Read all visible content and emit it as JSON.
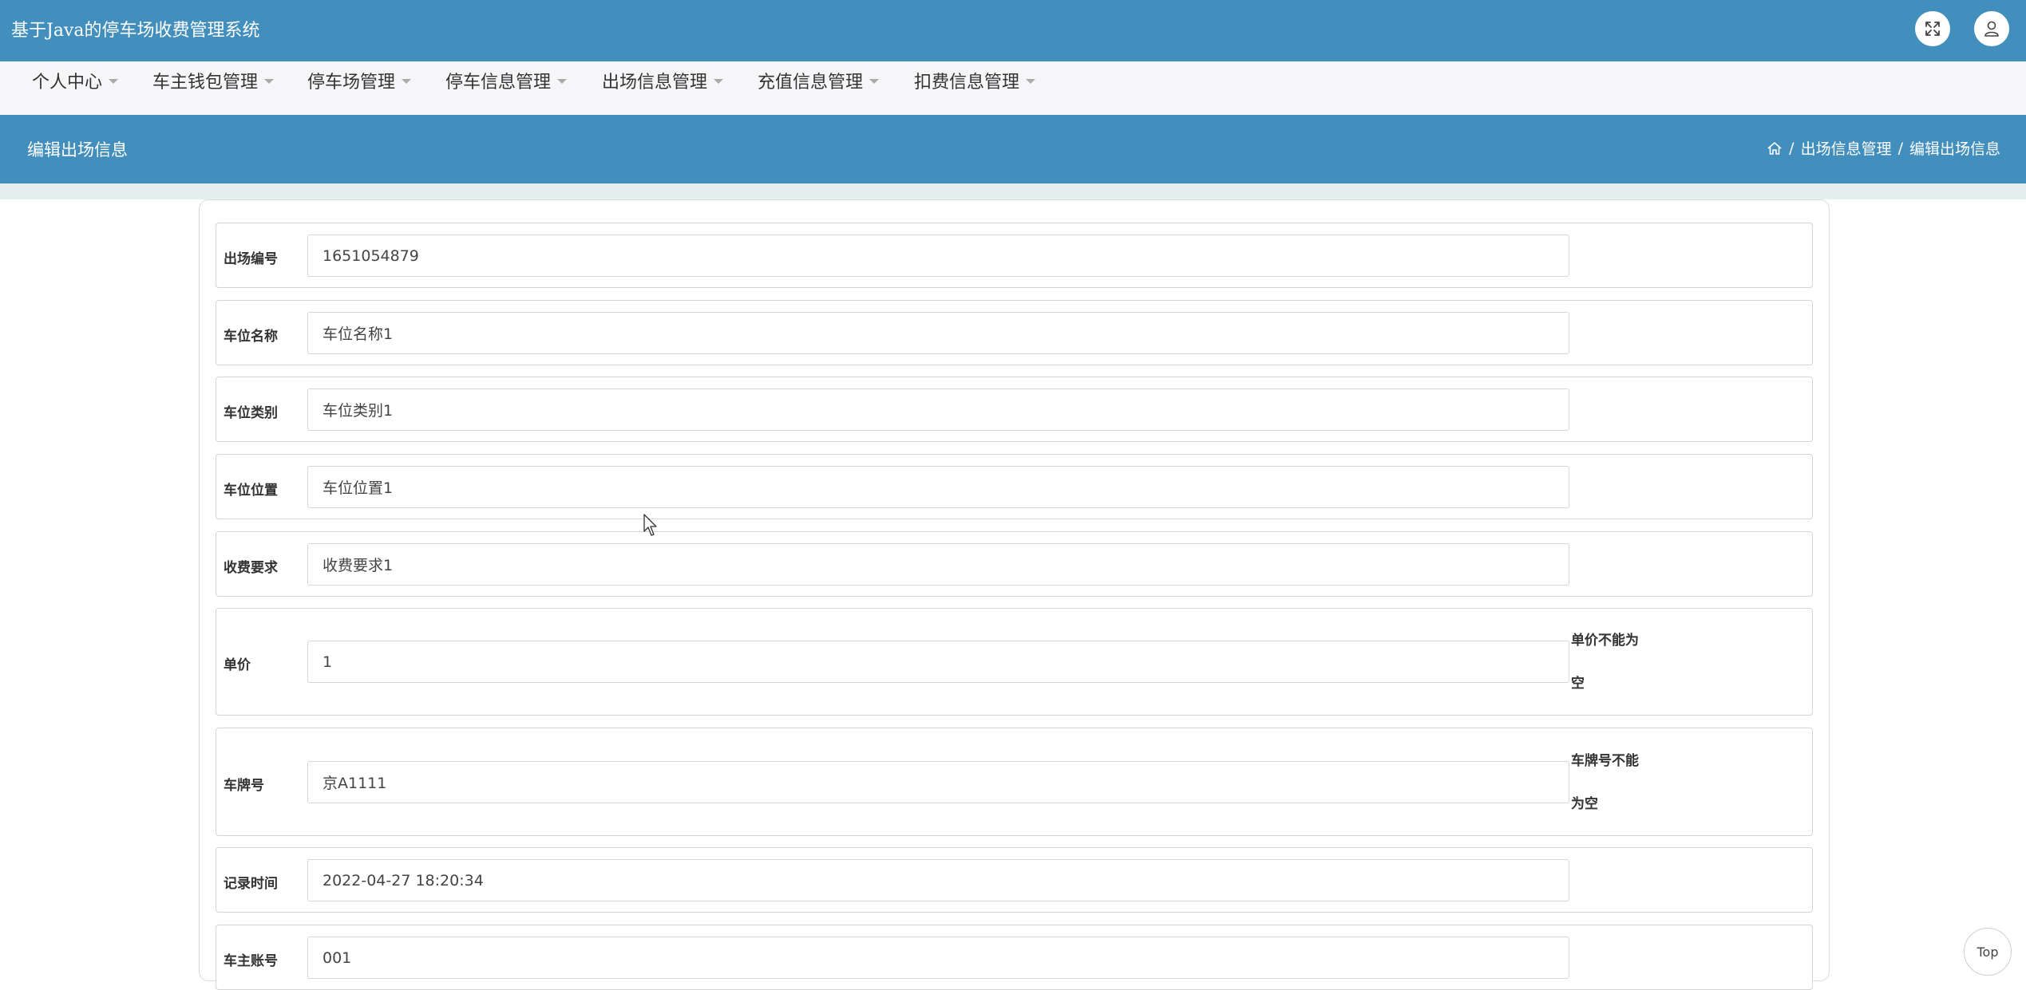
{
  "app": {
    "title": "基于Java的停车场收费管理系统"
  },
  "header_icons": {
    "fullscreen": "fullscreen-icon",
    "user": "user-icon"
  },
  "nav": [
    {
      "label": "个人中心"
    },
    {
      "label": "车主钱包管理"
    },
    {
      "label": "停车场管理"
    },
    {
      "label": "停车信息管理"
    },
    {
      "label": "出场信息管理"
    },
    {
      "label": "充值信息管理"
    },
    {
      "label": "扣费信息管理"
    }
  ],
  "page": {
    "title": "编辑出场信息",
    "breadcrumb": {
      "sep": "/",
      "section": "出场信息管理",
      "current": "编辑出场信息"
    }
  },
  "form": {
    "exit_no": {
      "label": "出场编号",
      "value": "1651054879"
    },
    "space_name": {
      "label": "车位名称",
      "value": "车位名称1"
    },
    "space_type": {
      "label": "车位类别",
      "value": "车位类别1"
    },
    "space_location": {
      "label": "车位位置",
      "value": "车位位置1"
    },
    "fee_requirement": {
      "label": "收费要求",
      "value": "收费要求1"
    },
    "unit_price": {
      "label": "单价",
      "value": "1",
      "error": "单价不能为空"
    },
    "plate_no": {
      "label": "车牌号",
      "value": "京A1111",
      "error": "车牌号不能为空"
    },
    "record_time": {
      "label": "记录时间",
      "value": "2022-04-27 18:20:34"
    },
    "owner_account": {
      "label": "车主账号",
      "value": "001"
    }
  },
  "top_button": {
    "label": "Top"
  },
  "colors": {
    "primary": "#428fbd",
    "nav_bg": "#f6f5f8",
    "strip": "#e4f0f0"
  }
}
